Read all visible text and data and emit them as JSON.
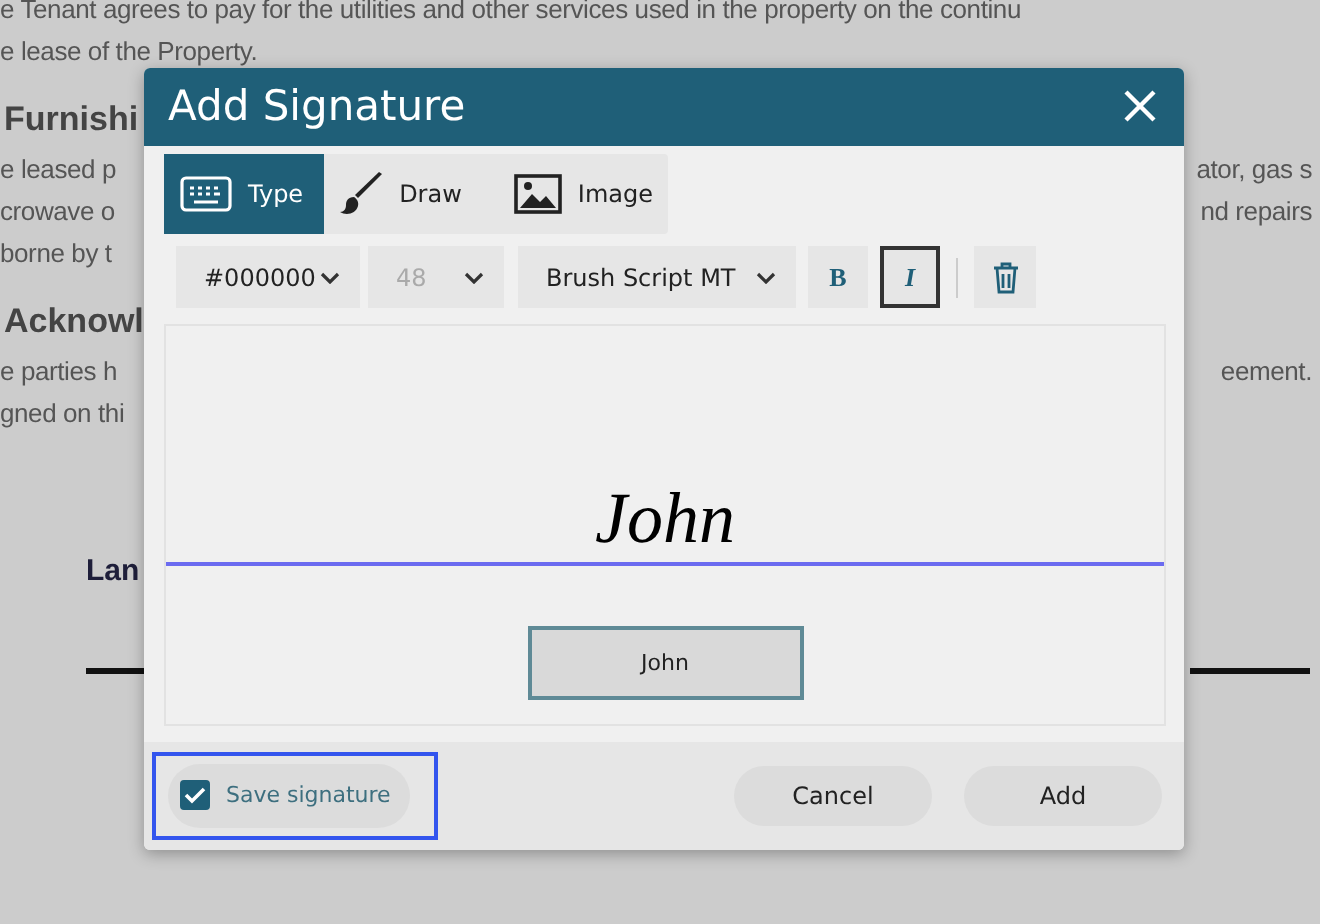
{
  "document": {
    "lines": [
      {
        "kind": "text",
        "left": "e Tenant agrees to pay for the utilities and other services used in the property on the continu"
      },
      {
        "kind": "text",
        "left": "e lease of the Property."
      },
      {
        "kind": "heading",
        "left": "Furnishi"
      },
      {
        "kind": "text",
        "left": "e leased p",
        "right": "ator, gas s"
      },
      {
        "kind": "text",
        "left": "crowave o",
        "right": "nd repairs"
      },
      {
        "kind": "text",
        "left": "borne by t"
      },
      {
        "kind": "heading",
        "left": "Acknowl"
      },
      {
        "kind": "text",
        "left": "e parties h",
        "right": "eement."
      },
      {
        "kind": "text",
        "left": "gned on thi"
      },
      {
        "kind": "label",
        "left": "Lan"
      }
    ]
  },
  "dialog": {
    "title": "Add Signature",
    "tabs": [
      {
        "kind": "keyboard",
        "label": "Type",
        "selected": true
      },
      {
        "kind": "brush",
        "label": "Draw",
        "selected": false
      },
      {
        "kind": "image",
        "label": "Image",
        "selected": false
      }
    ],
    "color_select": {
      "value": "#000000"
    },
    "size_select": {
      "value": "48",
      "disabled": true
    },
    "font_select": {
      "value": "Brush Script MT"
    },
    "bold": {
      "label": "B",
      "selected": false
    },
    "italic": {
      "label": "I",
      "selected": true
    },
    "signature": "John",
    "name_input": {
      "value": "John"
    },
    "save_signature": {
      "label": "Save signature",
      "checked": true
    },
    "buttons": [
      "Cancel",
      "Add"
    ]
  }
}
